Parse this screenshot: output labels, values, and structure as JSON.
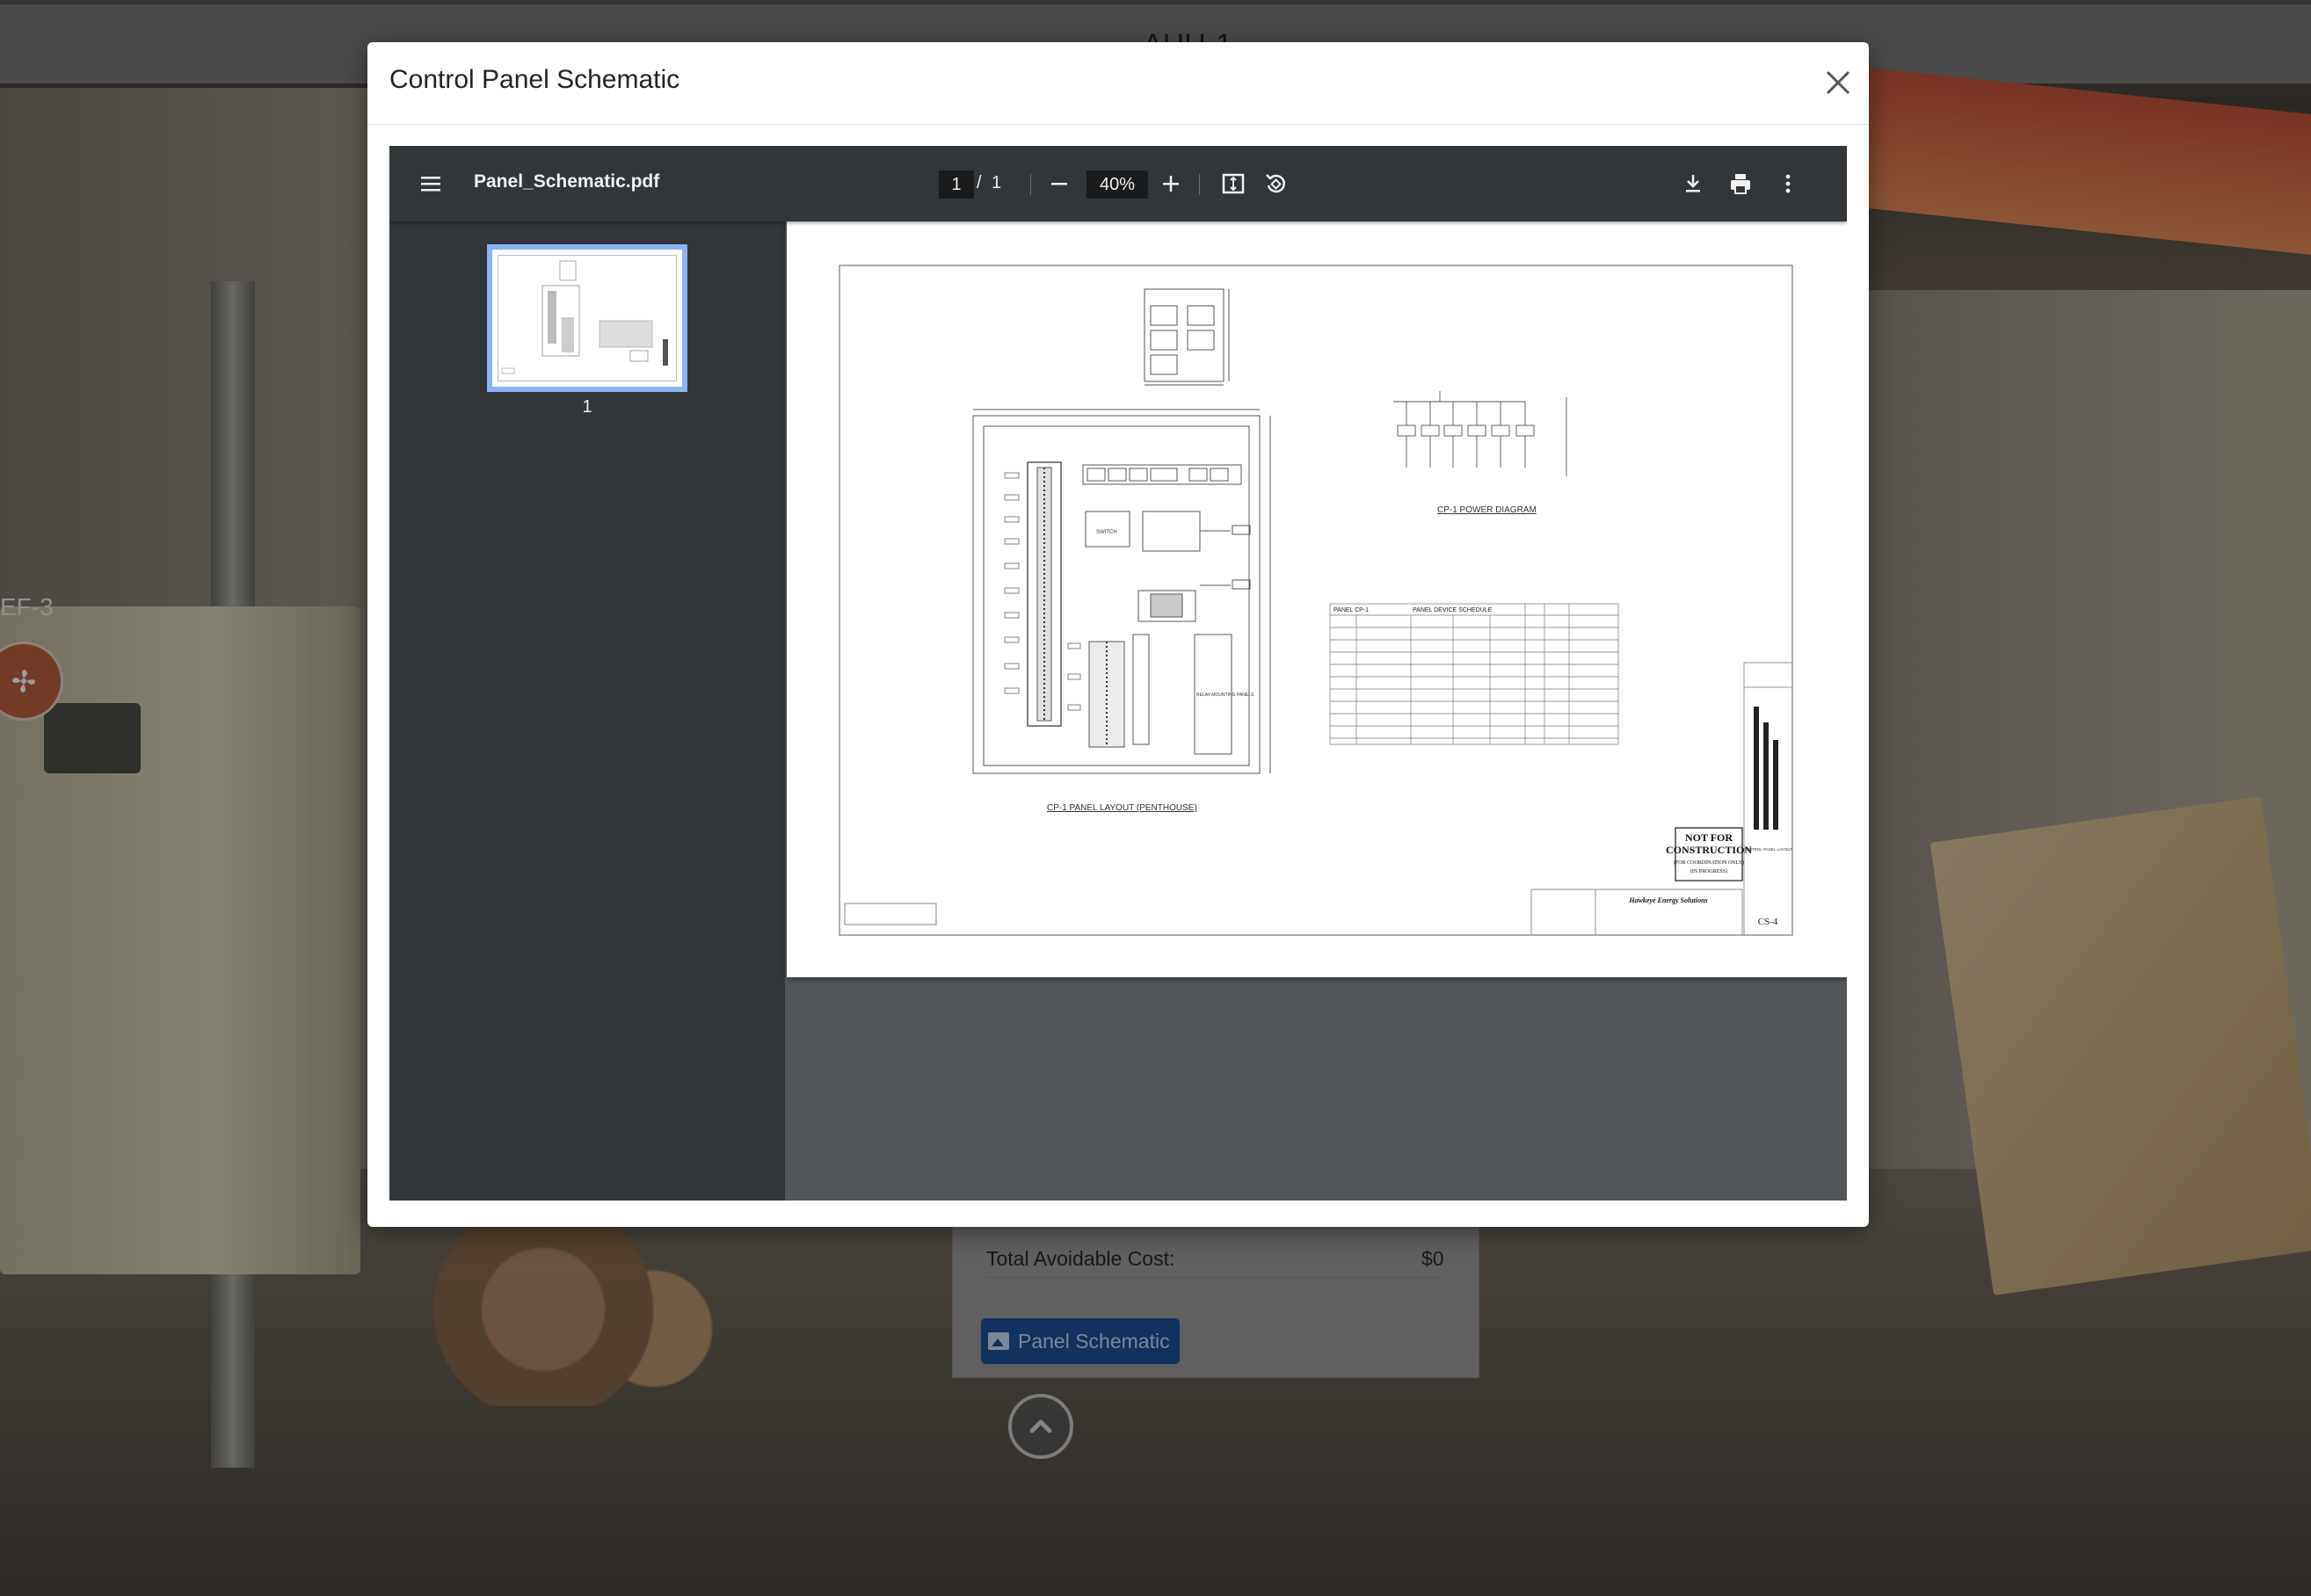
{
  "background": {
    "header_title": "AHU-1",
    "equipment_tag": "EF-3",
    "info_card": {
      "cost_label": "Total Avoidable Cost:",
      "cost_value": "$0",
      "schematic_button": "Panel Schematic"
    }
  },
  "modal": {
    "title": "Control Panel Schematic"
  },
  "viewer": {
    "file_name": "Panel_Schematic.pdf",
    "current_page": "1",
    "page_separator": "/",
    "total_pages": "1",
    "zoom": "40%",
    "thumbnail_label": "1"
  },
  "drawing": {
    "panel_layout_caption": "CP-1 PANEL LAYOUT (PENTHOUSE)",
    "power_diagram_caption": "CP-1 POWER DIAGRAM",
    "schedule_panel_label": "PANEL CP-1",
    "schedule_title": "PANEL DEVICE SCHEDULE",
    "switch_label": "SWITCH",
    "relay_label": "RELAY MOUNTING PANELS",
    "stamp_line1": "NOT FOR",
    "stamp_line2": "CONSTRUCTION",
    "stamp_line3": "(FOR COORDINATION ONLY)",
    "stamp_line4": "(IN PROGRESS)",
    "company": "Hawkeye Energy Solutions",
    "sheet_title": "CONTROL PANEL LAYOUT",
    "sheet_number": "CS-4"
  },
  "colors": {
    "accent_blue": "#1c4f9a",
    "thumb_border": "#8ab4f8",
    "toolbar": "#323639",
    "viewer_bg": "#525659"
  }
}
